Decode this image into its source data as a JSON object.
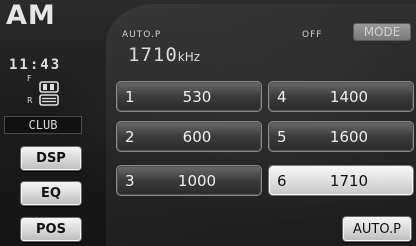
{
  "band": "AM",
  "clock": "11:43",
  "fader": {
    "front_label": "F",
    "rear_label": "R"
  },
  "eq_preset": "CLUB",
  "side_buttons": {
    "dsp": "DSP",
    "eq": "EQ",
    "pos": "POS"
  },
  "status": {
    "auto_p": "AUTO.P",
    "off": "OFF",
    "mode": "MODE"
  },
  "frequency": {
    "value": "1710",
    "unit": "kHz"
  },
  "presets": [
    {
      "num": "1",
      "freq": "530"
    },
    {
      "num": "2",
      "freq": "600"
    },
    {
      "num": "3",
      "freq": "1000"
    },
    {
      "num": "4",
      "freq": "1400"
    },
    {
      "num": "5",
      "freq": "1600"
    },
    {
      "num": "6",
      "freq": "1710"
    }
  ],
  "selected_preset": "6",
  "auto_p_button": "AUTO.P"
}
